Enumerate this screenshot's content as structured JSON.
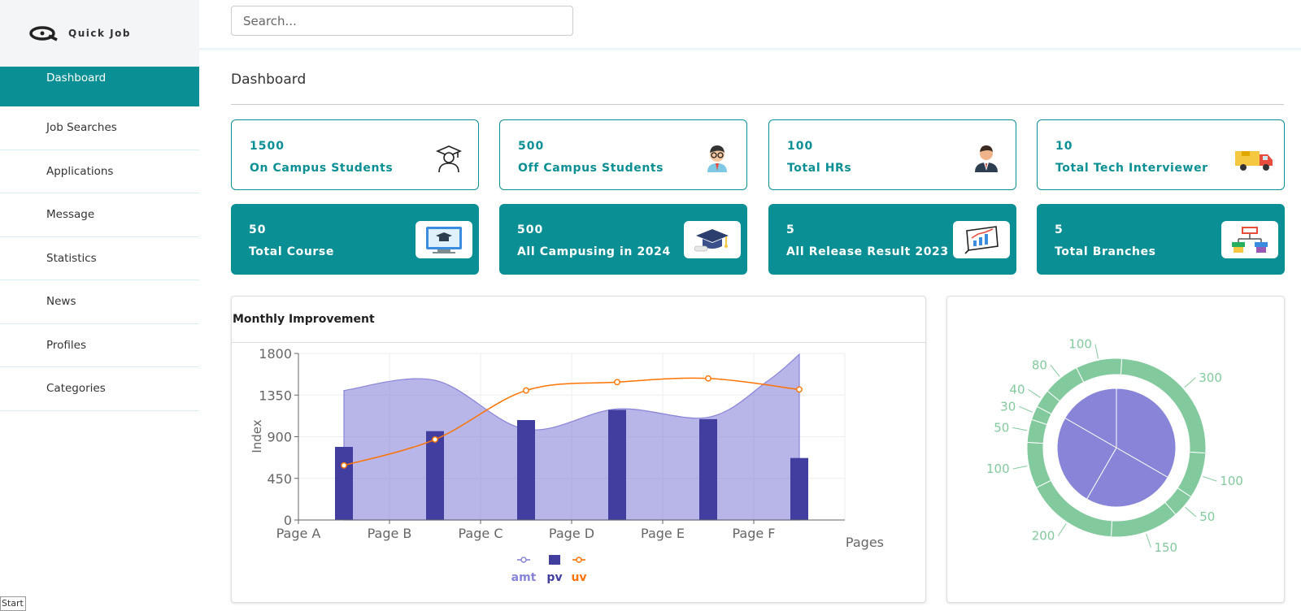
{
  "app": {
    "logo_text": "Quick Job"
  },
  "search": {
    "placeholder": "Search..."
  },
  "sidebar": {
    "items": [
      {
        "label": "Dashboard"
      },
      {
        "label": "Job Searches"
      },
      {
        "label": "Applications"
      },
      {
        "label": "Message"
      },
      {
        "label": "Statistics"
      },
      {
        "label": "News"
      },
      {
        "label": "Profiles"
      },
      {
        "label": "Categories"
      }
    ]
  },
  "taskbar": {
    "start_label": "Start"
  },
  "page": {
    "title": "Dashboard"
  },
  "stats_outline": [
    {
      "value": "1500",
      "label": "On Campus Students",
      "icon": "graduate-icon"
    },
    {
      "value": "500",
      "label": "Off Campus Students",
      "icon": "student-icon"
    },
    {
      "value": "100",
      "label": "Total HRs",
      "icon": "businessman-icon"
    },
    {
      "value": "10",
      "label": "Total Tech Interviewer",
      "icon": "truck-icon"
    }
  ],
  "stats_solid": [
    {
      "value": "50",
      "label": "Total Course",
      "icon": "online-course-icon"
    },
    {
      "value": "500",
      "label": "All Campusing in 2024",
      "icon": "graduation-cap-icon"
    },
    {
      "value": "5",
      "label": "All Release Result 2023",
      "icon": "result-chart-icon"
    },
    {
      "value": "5",
      "label": "Total Branches",
      "icon": "branches-icon"
    }
  ],
  "panels": {
    "monthly_title": "Monthly Improvement"
  },
  "colors": {
    "brand": "#0a8f95",
    "amt": "#8884d8",
    "pv": "#413ea0",
    "uv": "#ff7300",
    "pie_outer": "#82ca9d"
  },
  "chart_data": [
    {
      "type": "composed",
      "title": "Monthly Improvement",
      "xlabel": "Pages",
      "ylabel": "Index",
      "categories": [
        "Page A",
        "Page B",
        "Page C",
        "Page D",
        "Page E",
        "Page F"
      ],
      "ylim": [
        0,
        1800
      ],
      "yticks": [
        0,
        450,
        900,
        1350,
        1800
      ],
      "series": [
        {
          "name": "amt",
          "type": "area",
          "values": [
            1400,
            1510,
            980,
            1200,
            1110,
            1700
          ]
        },
        {
          "name": "pv",
          "type": "bar",
          "values": [
            790,
            960,
            1080,
            1190,
            1090,
            670
          ]
        },
        {
          "name": "uv",
          "type": "line",
          "values": [
            590,
            870,
            1400,
            1490,
            1530,
            1410
          ]
        }
      ],
      "extra_area_point": 1790,
      "grid": true,
      "legend": "bottom"
    },
    {
      "type": "pie",
      "inner": {
        "values": [
          400,
          300,
          300,
          200
        ]
      },
      "outer": {
        "values": [
          300,
          100,
          50,
          150,
          200,
          100,
          50,
          30,
          40,
          80,
          100
        ],
        "labels": [
          "300",
          "100",
          "50",
          "150",
          "200",
          "100",
          "50",
          "30",
          "40",
          "80",
          "100"
        ]
      }
    }
  ]
}
